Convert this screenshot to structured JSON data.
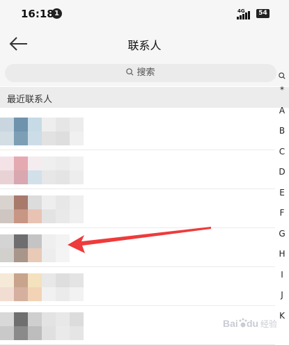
{
  "status_bar": {
    "time": "16:18",
    "notification_count": "1",
    "network": "4G",
    "battery": "54"
  },
  "header": {
    "title": "联系人",
    "back_icon": "arrow-left-icon"
  },
  "search": {
    "placeholder": "搜索"
  },
  "section": {
    "label": "最近联系人"
  },
  "contacts": [
    {
      "avatar_colors": [
        "#c9d6df",
        "#6f93ad",
        "#c7dbe6",
        "#d3dde4",
        "#7c9fb6",
        "#cddde8"
      ],
      "name_colors": [
        "#eeeeee",
        "#e6e6e6",
        "#ececec",
        "#e2e2e2",
        "#dedede",
        "#f0f0f0"
      ]
    },
    {
      "avatar_colors": [
        "#f3e3e6",
        "#e5a9b2",
        "#f4ecef",
        "#e9d2d6",
        "#d9a7b0",
        "#d2e0ea"
      ],
      "name_colors": [
        "#efefef",
        "#ececec",
        "#f1f1f1",
        "#e7e7e7",
        "#e4e4e4",
        "#ededed"
      ]
    },
    {
      "avatar_colors": [
        "#d9d3cf",
        "#a87a6c",
        "#dcdcdc",
        "#cfc6c1",
        "#c89684",
        "#e8c3b3"
      ],
      "name_colors": [
        "#eeeeee",
        "#e7e7e7",
        "#efefef",
        "#e3e3e3",
        "#e9e9e9",
        "#f0f0f0"
      ]
    },
    {
      "avatar_colors": [
        "#d4d4d4",
        "#6e6e71",
        "#c4c4c4",
        "#d2d0cd",
        "#a8968a",
        "#e8cab7"
      ],
      "name_colors": [
        "#efefef",
        "#f3f3f3",
        "#ededed",
        "#f4f4f4"
      ]
    },
    {
      "avatar_colors": [
        "#f5ead8",
        "#c8a48c",
        "#f4e1bd",
        "#f2ddd2",
        "#d6b09f",
        "#f3d3b6"
      ],
      "name_colors": [
        "#e8e8e8",
        "#dedede",
        "#e4e4e4",
        "#f1f1f1",
        "#ebebeb",
        "#f2f2f2"
      ]
    },
    {
      "avatar_colors": [
        "#d8d8d8",
        "#6f6f6f",
        "#cfcfcf",
        "#c9c9c9",
        "#8a8a8a",
        "#bdbdbd"
      ],
      "name_colors": [
        "#e3e3e3",
        "#e8e8e8",
        "#dcdcdc",
        "#e0e0e0",
        "#eaeaea",
        "#e5e5e5"
      ]
    }
  ],
  "index": {
    "search_icon": "search-icon",
    "letters": [
      "*",
      "A",
      "B",
      "C",
      "D",
      "E",
      "F",
      "G",
      "H",
      "I",
      "J",
      "K"
    ]
  },
  "annotation": {
    "arrow_color": "#ee3b3b",
    "arrow_icon": "red-arrow-icon"
  },
  "watermark": {
    "text": "Baidu 经验",
    "logo": "baidu-paw-icon"
  },
  "colors": {
    "accent": "#ee3b3b",
    "background": "#f6f6f6",
    "section": "#ececec"
  }
}
